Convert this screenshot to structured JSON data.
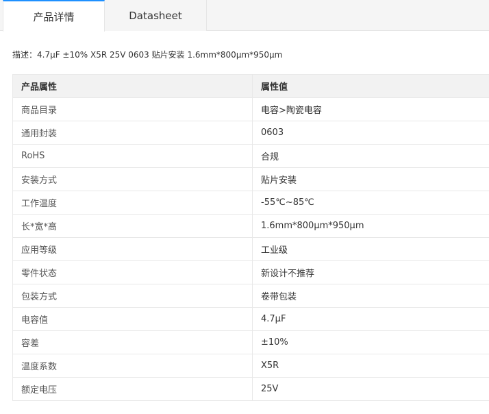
{
  "tabs": [
    {
      "label": "产品详情",
      "active": true
    },
    {
      "label": "Datasheet",
      "active": false
    }
  ],
  "description": "描述：4.7μF ±10% X5R 25V 0603 贴片安装 1.6mm*800μm*950μm",
  "table": {
    "headers": [
      "产品属性",
      "属性值"
    ],
    "rows": [
      [
        "商品目录",
        "电容>陶瓷电容"
      ],
      [
        "通用封装",
        "0603"
      ],
      [
        "RoHS",
        "合规"
      ],
      [
        "安装方式",
        "贴片安装"
      ],
      [
        "工作温度",
        "-55℃~85℃"
      ],
      [
        "长*宽*高",
        "1.6mm*800μm*950μm"
      ],
      [
        "应用等级",
        "工业级"
      ],
      [
        "零件状态",
        "新设计不推荐"
      ],
      [
        "包装方式",
        "卷带包装"
      ],
      [
        "电容值",
        "4.7μF"
      ],
      [
        "容差",
        "±10%"
      ],
      [
        "温度系数",
        "X5R"
      ],
      [
        "额定电压",
        "25V"
      ]
    ]
  },
  "colors": {
    "accent": "#1e90ff",
    "header_bg": "#f2f2f2",
    "border": "#e8e8e8"
  }
}
